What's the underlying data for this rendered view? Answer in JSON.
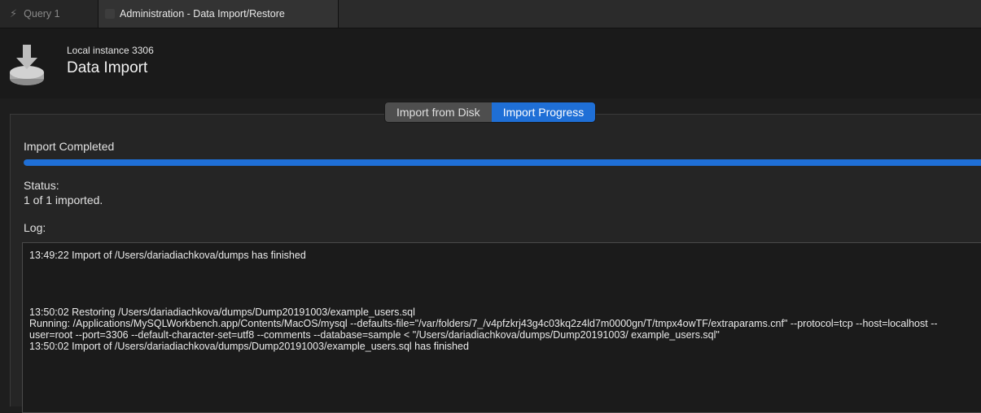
{
  "tabs": [
    {
      "label": "Query 1",
      "active": false
    },
    {
      "label": "Administration - Data Import/Restore",
      "active": true
    }
  ],
  "header": {
    "subtitle": "Local instance 3306",
    "title": "Data Import",
    "icon": "database-import-icon"
  },
  "segments": [
    {
      "label": "Import from Disk",
      "selected": false
    },
    {
      "label": "Import Progress",
      "selected": true
    }
  ],
  "progress": {
    "status_title": "Import Completed",
    "fraction": 1.0
  },
  "status": {
    "label": "Status:",
    "value": "1 of 1 imported."
  },
  "log": {
    "label": "Log:",
    "entry1": "13:49:22 Import of /Users/dariadiachkova/dumps has finished",
    "entry2": "13:50:02 Restoring /Users/dariadiachkova/dumps/Dump20191003/example_users.sql",
    "entry3": "Running: /Applications/MySQLWorkbench.app/Contents/MacOS/mysql --defaults-file=\"/var/folders/7_/v4pfzkrj43g4c03kq2z4ld7m0000gn/T/tmpx4owTF/extraparams.cnf\" --protocol=tcp --host=localhost --user=root --port=3306 --default-character-set=utf8 --comments --database=sample < \"/Users/dariadiachkova/dumps/Dump20191003/ example_users.sql\"",
    "entry4": "13:50:02 Import of /Users/dariadiachkova/dumps/Dump20191003/example_users.sql has finished"
  },
  "colors": {
    "accent": "#1f6fd6",
    "background": "#1e1e1e",
    "panel": "#252525"
  }
}
